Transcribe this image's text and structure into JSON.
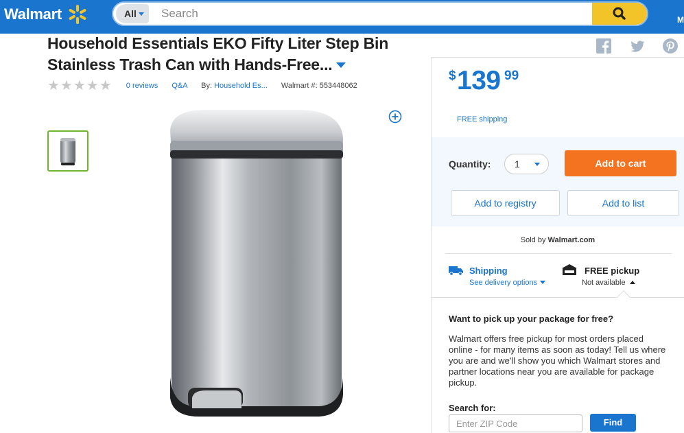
{
  "header": {
    "logo_text": "Walmart",
    "search": {
      "department": "All",
      "placeholder": "Search"
    },
    "cut_text": "M"
  },
  "product": {
    "title": "Household Essentials EKO Fifty Liter Step Bin Stainless Trash Can with Hands-Free...",
    "reviews": "0 reviews",
    "qa": "Q&A",
    "by_label": "By:",
    "brand": "Household Es...",
    "walmart_number": "Walmart #: 553448062",
    "rating": 0,
    "stars_max": 5
  },
  "price": {
    "currency": "$",
    "dollars": "139",
    "cents": "99"
  },
  "shipping_note": "FREE shipping",
  "purchase": {
    "quantity_label": "Quantity:",
    "quantity_value": "1",
    "add_to_cart": "Add to cart",
    "add_to_registry": "Add to registry",
    "add_to_list": "Add to list"
  },
  "seller": {
    "sold_by": "Sold by",
    "seller_name": "Walmart.com"
  },
  "fulfillment": {
    "shipping_title": "Shipping",
    "shipping_link": "See delivery options",
    "pickup_title": "FREE pickup",
    "pickup_status": "Not available"
  },
  "pickup_popover": {
    "question": "Want to pick up your package for free?",
    "body": "Walmart offers free pickup for most orders placed online - for many items as soon as today! Tell us where you are and we'll show you which Walmart stores and partner locations near you are available for package pickup.",
    "search_label": "Search for:",
    "zip_placeholder": "Enter ZIP Code",
    "find_button": "Find"
  },
  "colors": {
    "brand_blue": "#1a75cf",
    "spark_yellow": "#f3c32a",
    "cart_orange": "#f47321",
    "thumb_border": "#6fb52c"
  },
  "icons": [
    "spark-logo-icon",
    "search-icon",
    "facebook-icon",
    "twitter-icon",
    "pinterest-icon",
    "zoom-plus-icon",
    "truck-icon",
    "store-icon"
  ]
}
